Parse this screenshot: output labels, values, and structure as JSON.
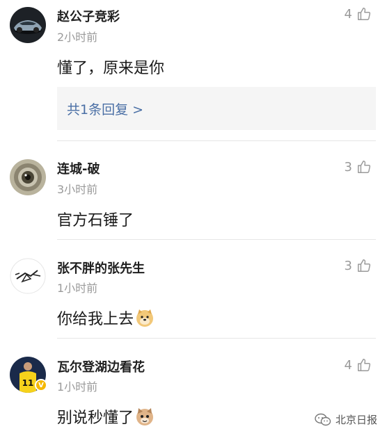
{
  "comments": [
    {
      "username": "赵公子竞彩",
      "time": "2小时前",
      "text": "懂了，原来是你",
      "likes": "4",
      "avatar": "car-avatar",
      "reply_summary": "共1条回复 >"
    },
    {
      "username": "连城-破",
      "time": "3小时前",
      "text": "官方石锤了",
      "likes": "3",
      "avatar": "eye-avatar"
    },
    {
      "username": "张不胖的张先生",
      "time": "1小时前",
      "text": "你给我上去",
      "likes": "3",
      "avatar": "sketch-avatar",
      "emoji": "doge-emoji"
    },
    {
      "username": "瓦尔登湖边看花",
      "time": "1小时前",
      "text": "别说秒懂了",
      "likes": "4",
      "avatar": "footballer-avatar",
      "verified_badge": "V",
      "emoji": "cat-emoji"
    }
  ],
  "icons": {
    "like": "thumbs-up-icon"
  },
  "watermark": {
    "text": "北京日报",
    "icon": "wechat-icon"
  },
  "colors": {
    "reply_link": "#4a6fa5",
    "meta_gray": "#9a9a9a",
    "badge": "#f5b800"
  }
}
